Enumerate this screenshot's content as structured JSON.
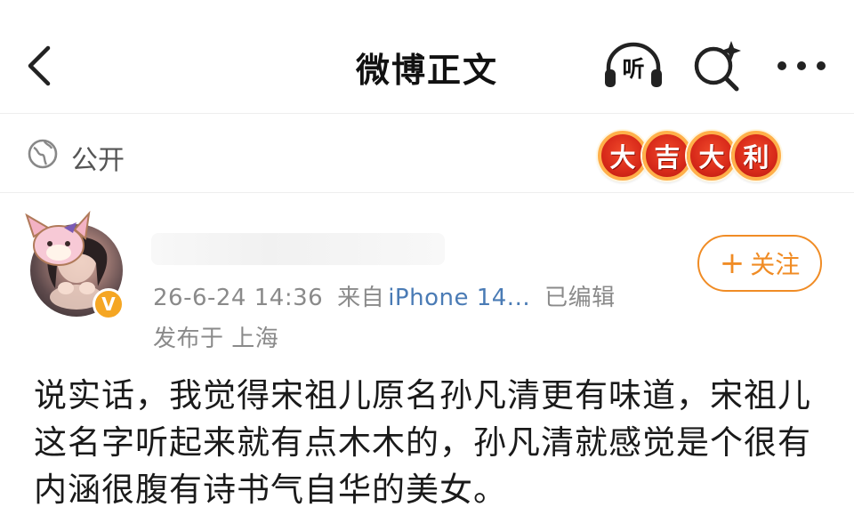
{
  "nav": {
    "title": "微博正文",
    "listen_label": "听",
    "back_icon": "chevron-left-icon",
    "listen_icon": "headphones-icon",
    "search_icon": "search-sparkle-icon",
    "more_icon": "more-dots-icon"
  },
  "visibility": {
    "label": "公开",
    "icon": "globe-icon"
  },
  "lucky_badge": {
    "chars": [
      "大",
      "吉",
      "大",
      "利"
    ],
    "colors": {
      "fill": "#d82a1a",
      "ring": "#ffb04a"
    }
  },
  "post": {
    "verified_badge": "V",
    "timestamp": "26-6-24 14:36",
    "from_label": "来自",
    "source": "iPhone 14...",
    "edited": "已编辑",
    "location": "发布于 上海",
    "follow_label": "关注",
    "text": "说实话，我觉得宋祖儿原名孙凡清更有味道，宋祖儿这名字听起来就有点木木的，孙凡清就感觉是个很有内涵很腹有诗书气自华的美女。"
  },
  "colors": {
    "accent": "#f08c25",
    "link": "#4a7bb5",
    "muted": "#8a8a8a"
  }
}
